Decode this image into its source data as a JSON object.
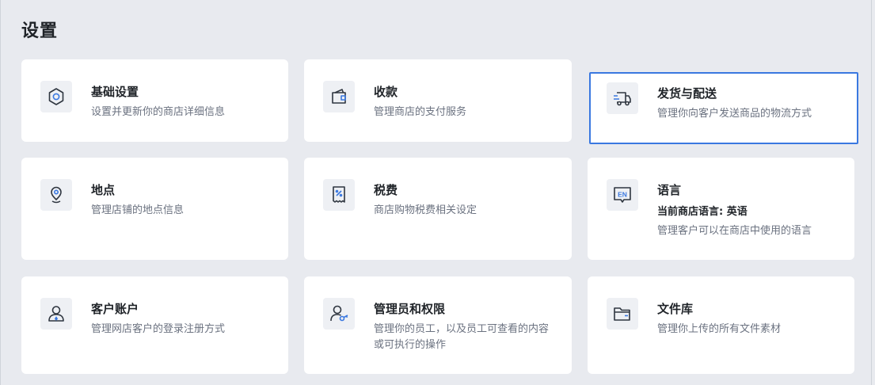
{
  "page": {
    "title": "设置"
  },
  "cards": [
    {
      "title": "基础设置",
      "desc": "设置并更新你的商店详细信息",
      "icon": "gear-icon"
    },
    {
      "title": "收款",
      "desc": "管理商店的支付服务",
      "icon": "wallet-icon"
    },
    {
      "title": "发货与配送",
      "desc": "管理你向客户发送商品的物流方式",
      "icon": "truck-icon"
    },
    {
      "title": "地点",
      "desc": "管理店铺的地点信息",
      "icon": "location-pin-icon"
    },
    {
      "title": "税费",
      "desc": "商店购物税费相关设定",
      "icon": "tax-receipt-icon"
    },
    {
      "title": "语言",
      "subtitle": "当前商店语言: 英语",
      "desc": "管理客户可以在商店中使用的语言",
      "icon": "language-en-icon",
      "icon_text": "EN"
    },
    {
      "title": "客户账户",
      "desc": "管理网店客户的登录注册方式",
      "icon": "user-account-icon"
    },
    {
      "title": "管理员和权限",
      "desc": "管理你的员工，以及员工可查看的内容或可执行的操作",
      "icon": "user-key-icon"
    },
    {
      "title": "文件库",
      "desc": "管理你上传的所有文件素材",
      "icon": "folder-icon"
    }
  ],
  "colors": {
    "selected_border": "#3a78e0",
    "icon_stroke": "#2f3640",
    "icon_accent": "#3a78e0"
  }
}
